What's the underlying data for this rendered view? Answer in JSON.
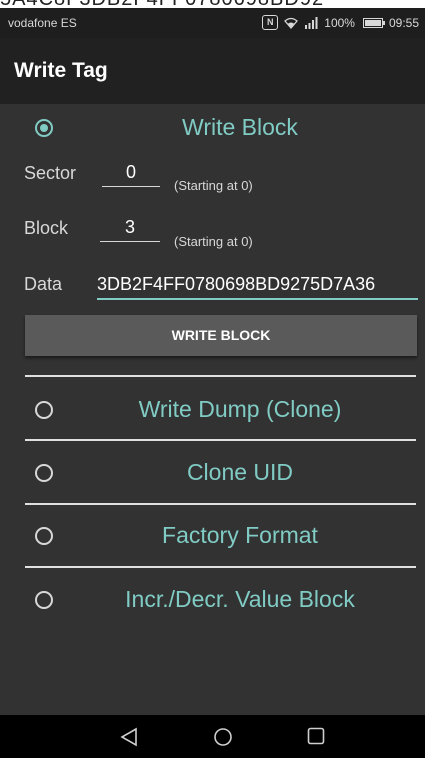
{
  "status_bar": {
    "carrier": "vodafone ES",
    "battery": "100%",
    "time": "09:55",
    "icons": [
      "nfc-icon",
      "wifi-icon",
      "signal-icon",
      "battery-icon"
    ]
  },
  "app_bar": {
    "title": "Write Tag"
  },
  "write_block": {
    "label": "Write Block",
    "selected": true,
    "sector_label": "Sector",
    "sector_value": "0",
    "sector_hint": "(Starting at 0)",
    "block_label": "Block",
    "block_value": "3",
    "block_hint": "(Starting at 0)",
    "data_label": "Data",
    "data_value": "3DB2F4FF0780698BD9275D7A36",
    "button_label": "WRITE BLOCK"
  },
  "options": [
    {
      "label": "Write Dump (Clone)",
      "selected": false
    },
    {
      "label": "Clone UID",
      "selected": false
    },
    {
      "label": "Factory Format",
      "selected": false
    },
    {
      "label": "Incr./Decr. Value Block",
      "selected": false
    }
  ],
  "colors": {
    "accent": "#80cbc4",
    "background": "#323232",
    "app_bar": "#212121",
    "button": "#5a5a5a"
  },
  "nav_bar": {
    "icons": [
      "back-icon",
      "home-icon",
      "recents-icon"
    ]
  }
}
